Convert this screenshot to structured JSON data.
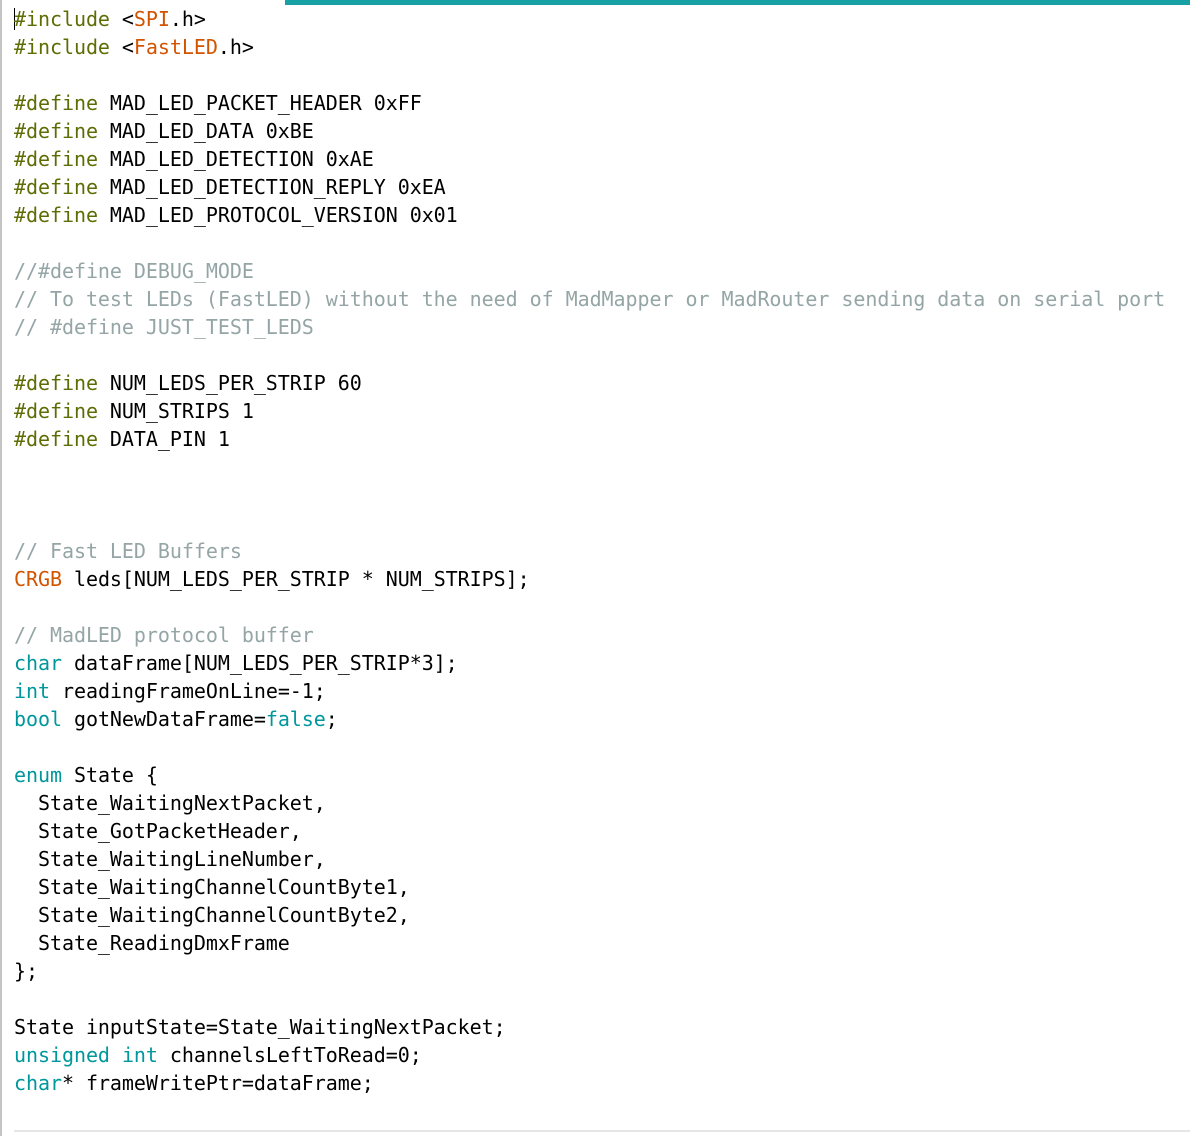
{
  "colors": {
    "default": "#000000",
    "preprocessor": "#5e6d03",
    "comment": "#95a5a6",
    "type": "#00979c",
    "literal": "#00979c",
    "library": "#d35400",
    "accent_bar": "#17a1a5"
  },
  "editor": {
    "lines": [
      [
        {
          "t": "#include",
          "s": "preprocessor"
        },
        {
          "t": " <"
        },
        {
          "t": "SPI",
          "s": "library"
        },
        {
          "t": ".h>"
        }
      ],
      [
        {
          "t": "#include",
          "s": "preprocessor"
        },
        {
          "t": " <"
        },
        {
          "t": "FastLED",
          "s": "library"
        },
        {
          "t": ".h>"
        }
      ],
      [],
      [
        {
          "t": "#define",
          "s": "preprocessor"
        },
        {
          "t": " MAD_LED_PACKET_HEADER 0xFF"
        }
      ],
      [
        {
          "t": "#define",
          "s": "preprocessor"
        },
        {
          "t": " MAD_LED_DATA 0xBE"
        }
      ],
      [
        {
          "t": "#define",
          "s": "preprocessor"
        },
        {
          "t": " MAD_LED_DETECTION 0xAE"
        }
      ],
      [
        {
          "t": "#define",
          "s": "preprocessor"
        },
        {
          "t": " MAD_LED_DETECTION_REPLY 0xEA"
        }
      ],
      [
        {
          "t": "#define",
          "s": "preprocessor"
        },
        {
          "t": " MAD_LED_PROTOCOL_VERSION 0x01"
        }
      ],
      [],
      [
        {
          "t": "//#define DEBUG_MODE",
          "s": "comment"
        }
      ],
      [
        {
          "t": "// To test LEDs (FastLED) without the need of MadMapper or MadRouter sending data on serial port",
          "s": "comment"
        }
      ],
      [
        {
          "t": "// #define JUST_TEST_LEDS",
          "s": "comment"
        }
      ],
      [],
      [
        {
          "t": "#define",
          "s": "preprocessor"
        },
        {
          "t": " NUM_LEDS_PER_STRIP 60"
        }
      ],
      [
        {
          "t": "#define",
          "s": "preprocessor"
        },
        {
          "t": " NUM_STRIPS 1"
        }
      ],
      [
        {
          "t": "#define",
          "s": "preprocessor"
        },
        {
          "t": " DATA_PIN 1"
        }
      ],
      [],
      [],
      [],
      [
        {
          "t": "// Fast LED Buffers",
          "s": "comment"
        }
      ],
      [
        {
          "t": "CRGB",
          "s": "library"
        },
        {
          "t": " leds[NUM_LEDS_PER_STRIP * NUM_STRIPS];"
        }
      ],
      [],
      [
        {
          "t": "// MadLED protocol buffer",
          "s": "comment"
        }
      ],
      [
        {
          "t": "char",
          "s": "type"
        },
        {
          "t": " dataFrame[NUM_LEDS_PER_STRIP*3];"
        }
      ],
      [
        {
          "t": "int",
          "s": "type"
        },
        {
          "t": " readingFrameOnLine=-1;"
        }
      ],
      [
        {
          "t": "bool",
          "s": "type"
        },
        {
          "t": " gotNewDataFrame="
        },
        {
          "t": "false",
          "s": "literal"
        },
        {
          "t": ";"
        }
      ],
      [],
      [
        {
          "t": "enum",
          "s": "type"
        },
        {
          "t": " State {"
        }
      ],
      [
        {
          "t": "  State_WaitingNextPacket,"
        }
      ],
      [
        {
          "t": "  State_GotPacketHeader,"
        }
      ],
      [
        {
          "t": "  State_WaitingLineNumber,"
        }
      ],
      [
        {
          "t": "  State_WaitingChannelCountByte1,"
        }
      ],
      [
        {
          "t": "  State_WaitingChannelCountByte2,"
        }
      ],
      [
        {
          "t": "  State_ReadingDmxFrame"
        }
      ],
      [
        {
          "t": "};"
        }
      ],
      [],
      [
        {
          "t": "State inputState=State_WaitingNextPacket;"
        }
      ],
      [
        {
          "t": "unsigned",
          "s": "type"
        },
        {
          "t": " "
        },
        {
          "t": "int",
          "s": "type"
        },
        {
          "t": " channelsLeftToRead=0;"
        }
      ],
      [
        {
          "t": "char",
          "s": "type"
        },
        {
          "t": "* frameWritePtr=dataFrame;"
        }
      ]
    ]
  }
}
